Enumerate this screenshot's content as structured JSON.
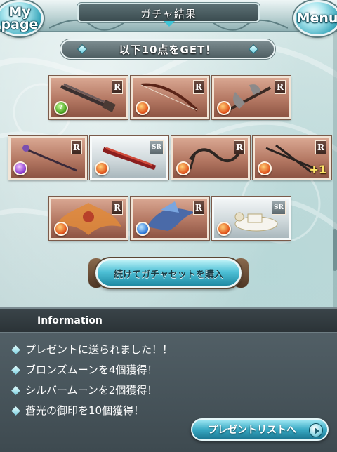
{
  "header": {
    "title": "ガチャ結果",
    "mypage_line1": "My",
    "mypage_line2": "page",
    "menu_label": "Menu"
  },
  "result_banner": "以下10点をGET！",
  "items": [
    {
      "name": "double-barrel-gun",
      "rarity": "R",
      "element": "wind",
      "element_glyph": "?"
    },
    {
      "name": "longbow",
      "rarity": "R",
      "element": "fire",
      "element_glyph": ""
    },
    {
      "name": "battle-axe",
      "rarity": "R",
      "element": "fire",
      "element_glyph": ""
    },
    {
      "name": "ornate-staff",
      "rarity": "R",
      "element": "dark",
      "element_glyph": ""
    },
    {
      "name": "crimson-rifle",
      "rarity": "SR",
      "element": "fire",
      "element_glyph": ""
    },
    {
      "name": "claw-weapon",
      "rarity": "R",
      "element": "fire",
      "element_glyph": ""
    },
    {
      "name": "twin-swords",
      "rarity": "R",
      "element": "fire",
      "element_glyph": "",
      "bonus": "+1"
    },
    {
      "name": "flame-summon",
      "rarity": "R",
      "element": "fire",
      "element_glyph": ""
    },
    {
      "name": "dragon-summon",
      "rarity": "R",
      "element": "water",
      "element_glyph": ""
    },
    {
      "name": "tea-set",
      "rarity": "SR",
      "element": "fire",
      "element_glyph": ""
    }
  ],
  "buy_button": "続けてガチャセットを購入",
  "info": {
    "title": "Information",
    "lines": [
      "プレゼントに送られました！！",
      "ブロンズムーンを4個獲得！",
      "シルバームーンを2個獲得！",
      "蒼光の御印を10個獲得！"
    ]
  },
  "gift_button": "プレゼントリストへ",
  "colors": {
    "accent_cyan": "#3aa7bb",
    "r_frame": "#b47863",
    "sr_frame": "#d0d9dc",
    "info_bg": "#3e4a50"
  }
}
